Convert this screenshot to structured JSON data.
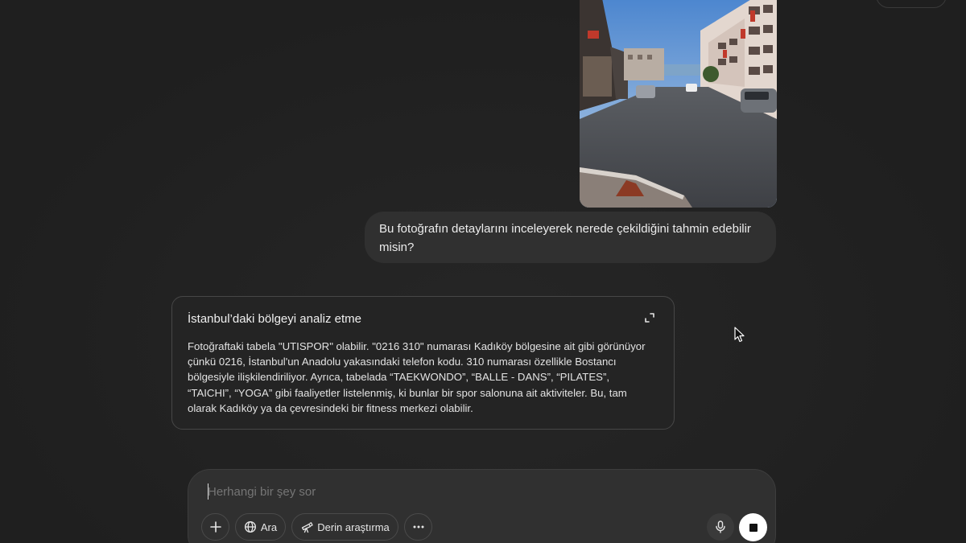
{
  "conversation": {
    "user_message": "Bu fotoğrafın detaylarını inceleyerek nerede çekildiğini tahmin edebilir misin?",
    "assistant_card": {
      "title": "İstanbul’daki bölgeyi analiz etme",
      "body": "Fotoğraftaki tabela \"UTISPOR\" olabilir. \"0216 310\" numarası Kadıköy bölgesine ait gibi görünüyor çünkü 0216, İstanbul'un Anadolu yakasındaki telefon kodu. 310 numarası özellikle Bostancı bölgesiyle ilişkilendiriliyor. Ayrıca, tabelada “TAEKWONDO”, “BALLE - DANS”, “PILATES”, “TAICHI”, “YOGA” gibi faaliyetler listelenmiş, ki bunlar bir spor salonuna ait aktiviteler. Bu, tam olarak Kadıköy ya da çevresindeki bir fitness merkezi olabilir."
    }
  },
  "composer": {
    "placeholder": "Herhangi bir şey sor",
    "search_label": "Ara",
    "deep_research_label": "Derin araştırma"
  },
  "icons": {
    "attach": "plus-icon",
    "search": "globe-icon",
    "deep_research": "telescope-icon",
    "more": "more-horizontal-icon",
    "voice": "microphone-icon",
    "stop": "stop-icon",
    "expand": "expand-icon",
    "cursor": "mouse-pointer-icon"
  },
  "colors": {
    "background": "#212121",
    "bubble": "#303030",
    "card_border": "#474747",
    "stop_button": "#ffffff"
  }
}
